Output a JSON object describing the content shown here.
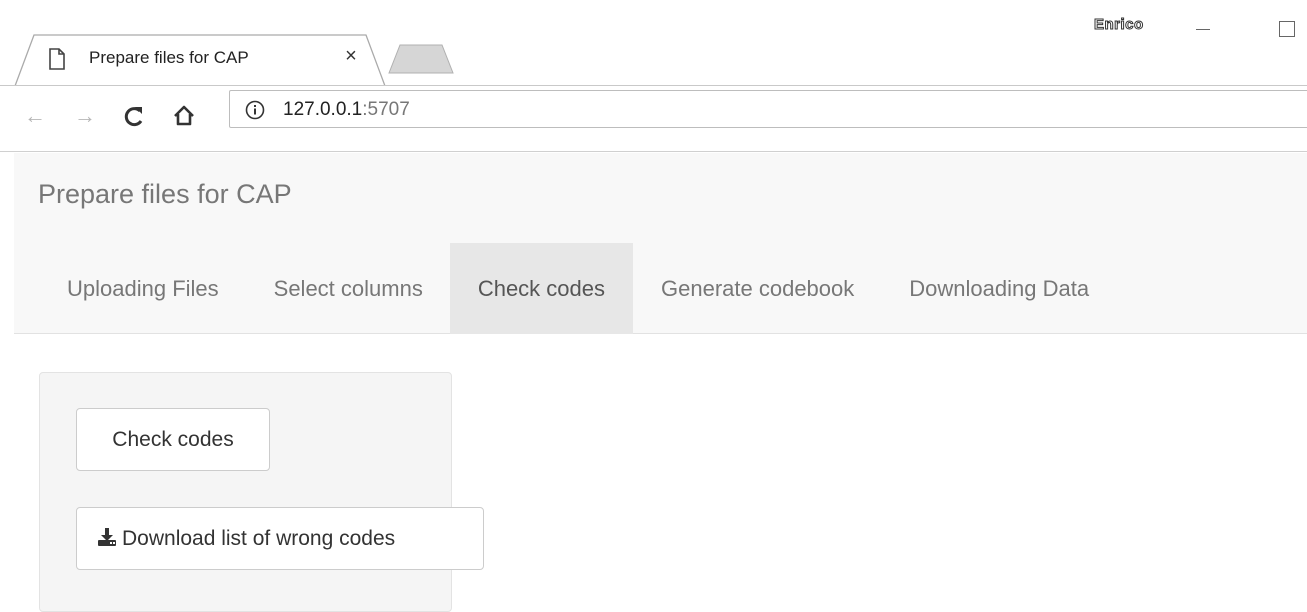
{
  "browser": {
    "tab": {
      "title": "Prepare files for CAP",
      "close_glyph": "×",
      "icon": "document-icon"
    },
    "profile_name": "Enrico",
    "window_controls": {
      "minimize_icon": "minimize-icon",
      "maximize_icon": "maximize-icon"
    },
    "toolbar": {
      "back_glyph": "←",
      "forward_glyph": "→",
      "reload_glyph": "C",
      "home_glyph": "⌂",
      "url_host": "127.0.0.1",
      "url_port": ":5707"
    }
  },
  "app": {
    "brand": "Prepare files for CAP",
    "tabs": [
      {
        "label": "Uploading Files",
        "active": false
      },
      {
        "label": "Select columns",
        "active": false
      },
      {
        "label": "Check codes",
        "active": true
      },
      {
        "label": "Generate codebook",
        "active": false
      },
      {
        "label": "Downloading Data",
        "active": false
      }
    ],
    "panel": {
      "check_button": "Check codes",
      "download_button": "Download list of wrong codes",
      "download_icon": "download-icon"
    }
  },
  "colors": {
    "navbar_bg": "#f8f8f8",
    "active_tab_bg": "#e7e7e7",
    "nav_text": "#777777",
    "panel_bg": "#f5f5f5"
  }
}
